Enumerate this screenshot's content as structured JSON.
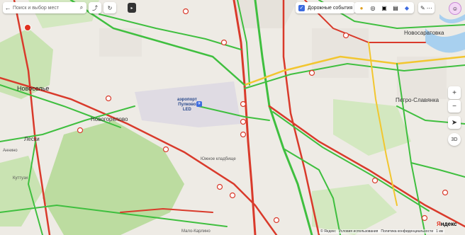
{
  "search": {
    "placeholder": "Поиск и выбор мест"
  },
  "traffic": {
    "checkbox": "✓",
    "label": "Дорожные события"
  },
  "places": {
    "novoselye": "Новоселье",
    "novogoreloevo": "Новогорелово",
    "airport": "аэропорт\nПулково\nLED",
    "yuzhnoe_kladbishche": "Южное кладбище",
    "leski": "Лески",
    "annino": "Аннино",
    "kuttuzi": "Куттузи",
    "petro_slavyanka": "Петро-Славянка",
    "novosaratovka": "Новосаратовка",
    "malo_karlino": "Мало-Карлино"
  },
  "controls": {
    "zoom_in": "+",
    "zoom_out": "−",
    "locate": "➤",
    "view3d": "3D"
  },
  "attribution": {
    "logo_y": "Я",
    "logo_rest": "ндекс",
    "copyright": "© Яндекс",
    "terms": "Условия использования",
    "privacy": "Политика конфиденциальности",
    "scale": "1 км"
  },
  "colors": {
    "jam_red": "#d93a2b",
    "slow_yellow": "#f2c62f",
    "free_green": "#3fbf3f",
    "park_green": "#c9e3b2",
    "water": "#a8d0ef"
  }
}
